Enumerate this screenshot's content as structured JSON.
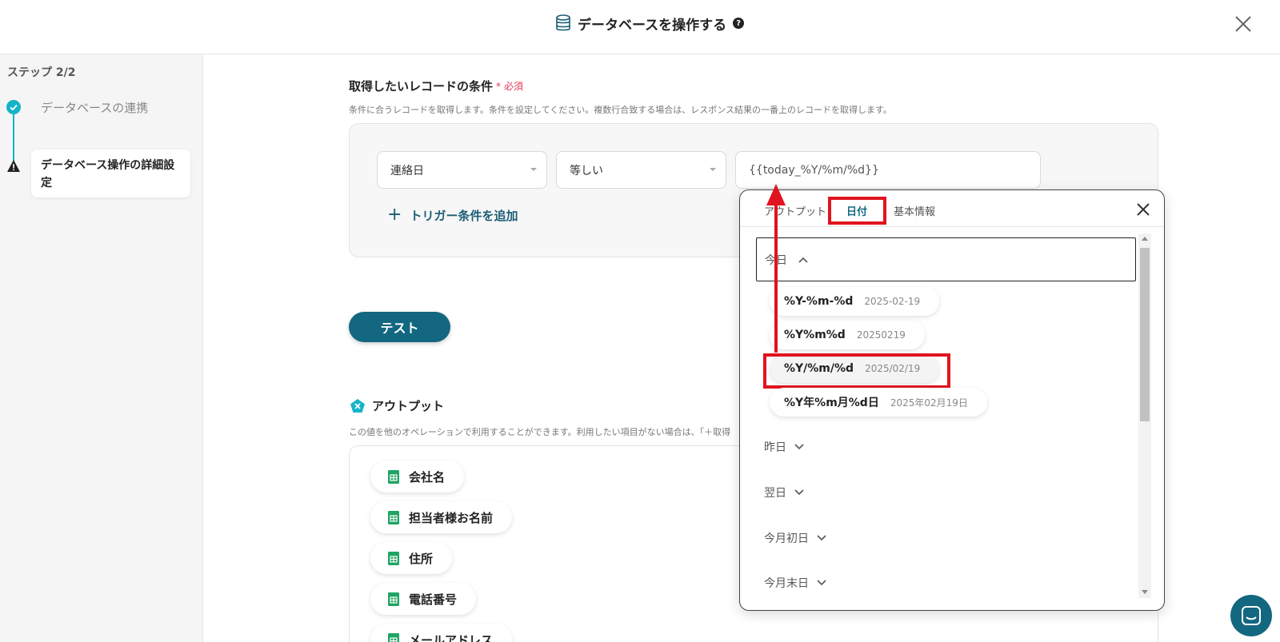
{
  "header": {
    "title": "データベースを操作する",
    "help_icon": "?"
  },
  "sidebar": {
    "step_label": "ステップ 2/2",
    "steps": [
      {
        "label": "データベースの連携",
        "status": "done"
      },
      {
        "label": "データベース操作の詳細設定",
        "status": "warning"
      }
    ]
  },
  "conditions": {
    "title": "取得したいレコードの条件",
    "required_mark": "*",
    "required": "必須",
    "description": "条件に合うレコードを取得します。条件を設定してください。複数行合致する場合は、レスポンス結果の一番上のレコードを取得します。",
    "field": "連絡日",
    "operator": "等しい",
    "value": "{{today_%Y/%m/%d}}",
    "add_trigger": "トリガー条件を追加"
  },
  "test_button": "テスト",
  "output": {
    "title": "アウトプット",
    "description": "この値を他のオペレーションで利用することができます。利用したい項目がない場合は、「＋取得",
    "items": [
      "会社名",
      "担当者様お名前",
      "住所",
      "電話番号",
      "メールアドレス"
    ]
  },
  "popup": {
    "tabs": [
      "アウトプット",
      "日付",
      "基本情報"
    ],
    "active_tab": "日付",
    "today_group": "今日",
    "formats": [
      {
        "format": "%Y-%m-%d",
        "value": "2025-02-19"
      },
      {
        "format": "%Y%m%d",
        "value": "20250219"
      },
      {
        "format": "%Y/%m/%d",
        "value": "2025/02/19"
      },
      {
        "format": "%Y年%m月%d日",
        "value": "2025年02月19日"
      }
    ],
    "groups": [
      "昨日",
      "翌日",
      "今月初日",
      "今月末日"
    ]
  },
  "colors": {
    "accent": "#136780",
    "teal": "#16b3c8",
    "highlight": "#e0141e",
    "required": "#e03a5a",
    "sheet_green": "#1fa463"
  }
}
